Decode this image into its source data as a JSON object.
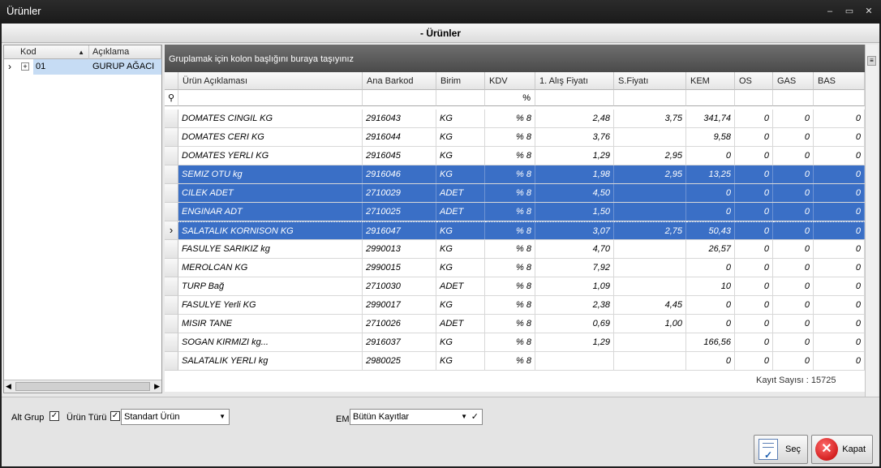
{
  "window": {
    "title": "Ürünler",
    "controls": [
      "–",
      "▭",
      "✕"
    ]
  },
  "form": {
    "header": "- Ürünler"
  },
  "tree": {
    "columns": [
      "Kod",
      "Açıklama"
    ],
    "rows": [
      {
        "kod": "01",
        "aciklama": "GURUP AĞACI"
      }
    ]
  },
  "grid": {
    "group_hint": "Gruplamak için kolon başlığını buraya taşıyınız",
    "columns": [
      "Ürün Açıklaması",
      "Ana Barkod",
      "Birim",
      "KDV",
      "1. Alış Fiyatı",
      "S.Fiyatı",
      "KEM",
      "OS",
      "GAS",
      "BAS"
    ],
    "filter_kdv": "%",
    "rows": [
      {
        "cells": [
          "DOMATES CINGIL  KG",
          "2916043",
          "KG",
          "% 8",
          "2,48",
          "3,75",
          "341,74",
          "0",
          "0",
          "0"
        ],
        "selected": false
      },
      {
        "cells": [
          "DOMATES CERI KG",
          "2916044",
          "KG",
          "% 8",
          "3,76",
          "",
          "9,58",
          "0",
          "0",
          "0"
        ],
        "selected": false
      },
      {
        "cells": [
          "DOMATES YERLI KG",
          "2916045",
          "KG",
          "% 8",
          "1,29",
          "2,95",
          "0",
          "0",
          "0",
          "0"
        ],
        "selected": false
      },
      {
        "cells": [
          "SEMIZ OTU kg",
          "2916046",
          "KG",
          "% 8",
          "1,98",
          "2,95",
          "13,25",
          "0",
          "0",
          "0"
        ],
        "selected": true
      },
      {
        "cells": [
          "CILEK ADET",
          "2710029",
          "ADET",
          "% 8",
          "4,50",
          "",
          "0",
          "0",
          "0",
          "0"
        ],
        "selected": true
      },
      {
        "cells": [
          "ENGINAR ADT",
          "2710025",
          "ADET",
          "% 8",
          "1,50",
          "",
          "0",
          "0",
          "0",
          "0"
        ],
        "selected": true
      },
      {
        "cells": [
          "SALATALIK KORNISON  KG",
          "2916047",
          "KG",
          "% 8",
          "3,07",
          "2,75",
          "50,43",
          "0",
          "0",
          "0"
        ],
        "selected": true,
        "focused": true
      },
      {
        "cells": [
          "FASULYE SARIKIZ kg",
          "2990013",
          "KG",
          "% 8",
          "4,70",
          "",
          "26,57",
          "0",
          "0",
          "0"
        ],
        "selected": false
      },
      {
        "cells": [
          "MEROLCAN  KG",
          "2990015",
          "KG",
          "% 8",
          "7,92",
          "",
          "0",
          "0",
          "0",
          "0"
        ],
        "selected": false
      },
      {
        "cells": [
          "TURP Bağ",
          "2710030",
          "ADET",
          "% 8",
          "1,09",
          "",
          "10",
          "0",
          "0",
          "0"
        ],
        "selected": false
      },
      {
        "cells": [
          "FASULYE Yerli KG",
          "2990017",
          "KG",
          "% 8",
          "2,38",
          "4,45",
          "0",
          "0",
          "0",
          "0"
        ],
        "selected": false
      },
      {
        "cells": [
          "MISIR TANE",
          "2710026",
          "ADET",
          "% 8",
          "0,69",
          "1,00",
          "0",
          "0",
          "0",
          "0"
        ],
        "selected": false
      },
      {
        "cells": [
          "SOGAN KIRMIZI kg...",
          "2916037",
          "KG",
          "% 8",
          "1,29",
          "",
          "166,56",
          "0",
          "0",
          "0"
        ],
        "selected": false
      },
      {
        "cells": [
          "SALATALIK YERLI kg",
          "2980025",
          "KG",
          "% 8",
          "",
          "",
          "0",
          "0",
          "0",
          "0"
        ],
        "selected": false
      }
    ],
    "record_count": "Kayıt Sayısı : 15725"
  },
  "bottom": {
    "alt_grup_label": "Alt Grup",
    "urun_turu_label": "Ürün Türü",
    "urun_turu_value": "Standart Ürün",
    "em_label": "EM",
    "em_value": "Bütün Kayıtlar",
    "sec_label": "Seç",
    "kapat_label": "Kapat"
  },
  "colors": {
    "selection": "#3a6fc6",
    "titlebar": "#1f1f1f",
    "group_area": "#5a5a5a"
  }
}
